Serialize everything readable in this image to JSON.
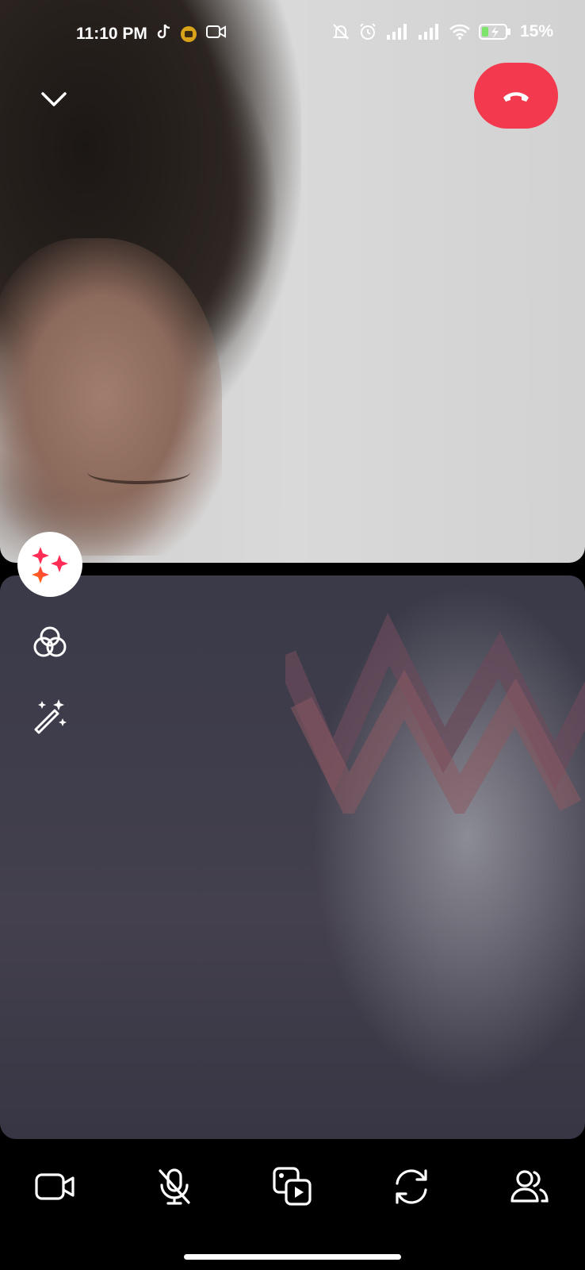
{
  "status_bar": {
    "time": "11:10 PM",
    "battery": "15%",
    "icons": [
      "tiktok-icon",
      "youtube-badge-icon",
      "video-status-icon",
      "mute-bell-icon",
      "alarm-icon",
      "signal-icon",
      "signal-icon",
      "wifi-icon",
      "battery-icon"
    ]
  },
  "header": {
    "collapse_icon": "chevron-down-icon",
    "end_call_icon": "phone-hangup-icon",
    "end_call_color": "#f2394d"
  },
  "side_tools": [
    {
      "name": "effects",
      "icon": "sparkles-icon",
      "active": true
    },
    {
      "name": "filters",
      "icon": "overlapping-circles-icon"
    },
    {
      "name": "touch-up",
      "icon": "magic-wand-icon"
    }
  ],
  "toolbar": [
    {
      "name": "camera",
      "icon": "video-camera-icon"
    },
    {
      "name": "microphone",
      "icon": "mic-off-icon",
      "muted": true
    },
    {
      "name": "share-media",
      "icon": "media-share-icon"
    },
    {
      "name": "flip-camera",
      "icon": "camera-flip-icon"
    },
    {
      "name": "participants",
      "icon": "people-icon"
    }
  ]
}
